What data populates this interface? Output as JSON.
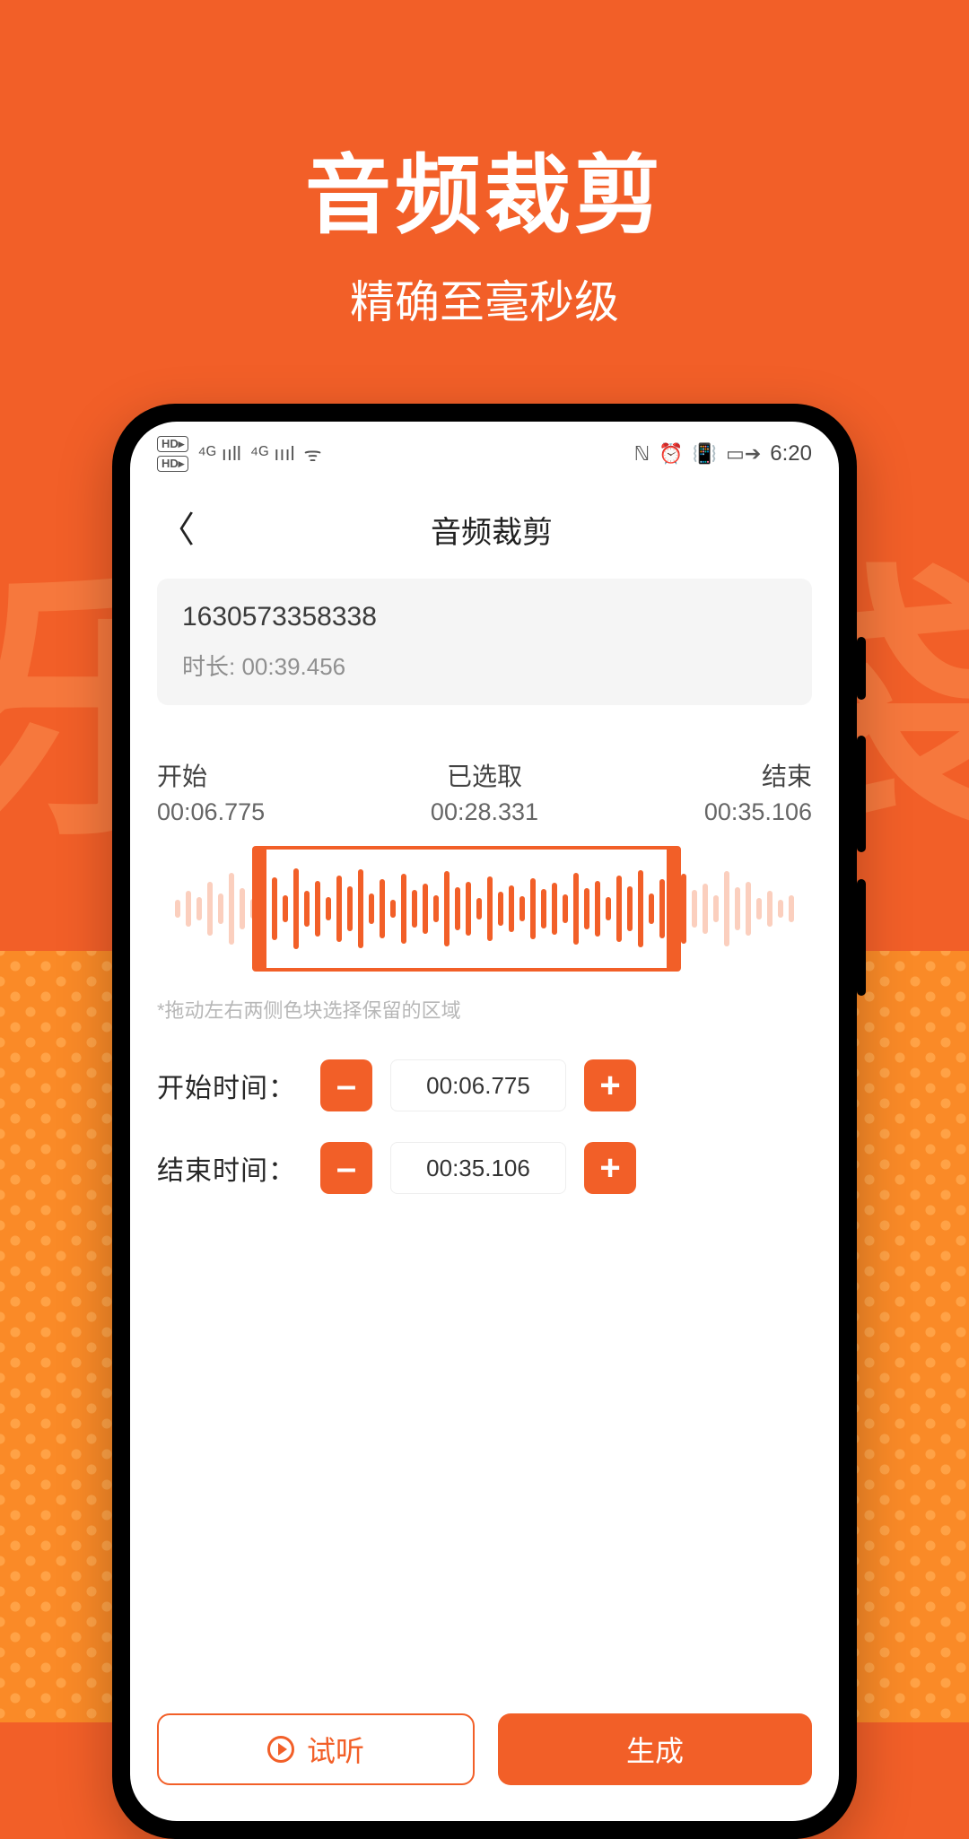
{
  "hero": {
    "title": "音频裁剪",
    "subtitle": "精确至毫秒级"
  },
  "statusbar": {
    "hd1": "HD▸",
    "hd2": "HD▸",
    "sig1": "⁴ᴳ ııll",
    "sig2": "⁴ᴳ ıııl",
    "wifi": "ᯤ",
    "nfc": "ℕ",
    "alarm": "⏰",
    "vib": "📳",
    "batt": "▭➔",
    "time": "6:20"
  },
  "appbar": {
    "title": "音频裁剪"
  },
  "file": {
    "name": "1630573358338",
    "duration_label": "时长:",
    "duration": "00:39.456"
  },
  "range": {
    "start_label": "开始",
    "sel_label": "已选取",
    "end_label": "结束",
    "start": "00:06.775",
    "selected": "00:28.331",
    "end": "00:35.106"
  },
  "hint": "*拖动左右两侧色块选择保留的区域",
  "controls": {
    "start_label": "开始时间：",
    "start_value": "00:06.775",
    "end_label": "结束时间：",
    "end_value": "00:35.106",
    "minus": "–",
    "plus": "+"
  },
  "bottom": {
    "preview": "试听",
    "generate": "生成"
  },
  "wave_heights": [
    20,
    40,
    26,
    60,
    34,
    80,
    46,
    22,
    58,
    70,
    30,
    90,
    40,
    62,
    26,
    74,
    50,
    88,
    34,
    66,
    20,
    78,
    42,
    56,
    30,
    84,
    48,
    60,
    24,
    72,
    38,
    52,
    28,
    68,
    44,
    58,
    32,
    80,
    46,
    62,
    26,
    74,
    50,
    86,
    34,
    66,
    22,
    78,
    42,
    56,
    30,
    84,
    48,
    60,
    24,
    40,
    20,
    30
  ],
  "wave_in_range": [
    8,
    47
  ]
}
